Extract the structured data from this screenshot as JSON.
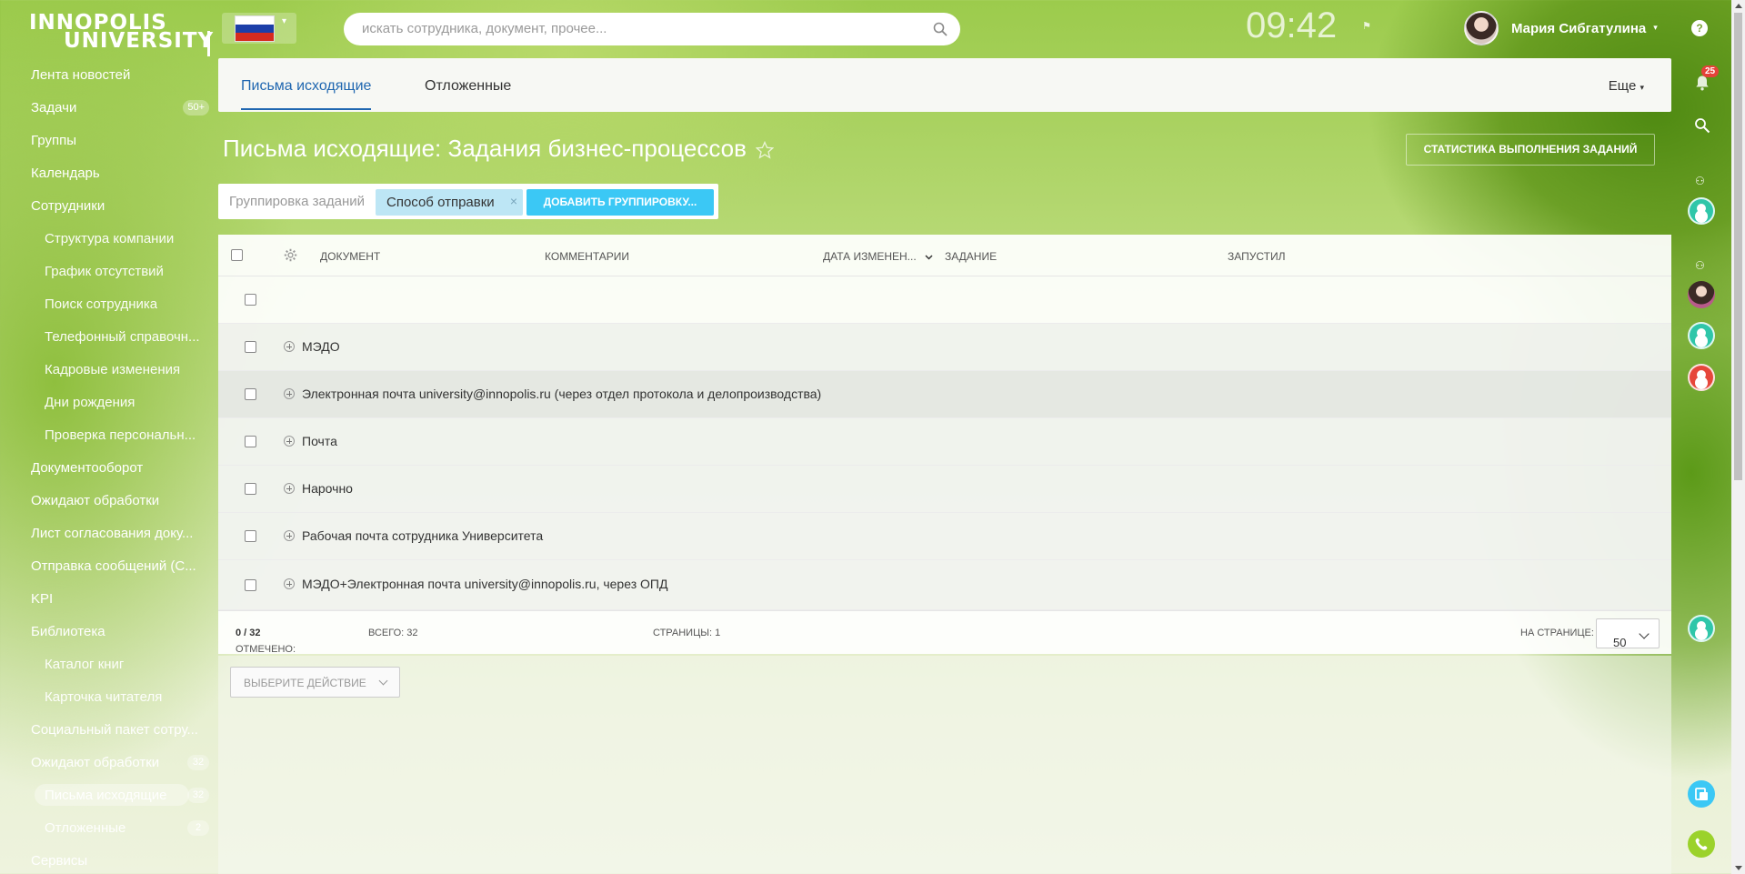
{
  "brand": {
    "line1": "INNOPOLIS",
    "line2": "UNIVERSITY"
  },
  "search": {
    "placeholder": "искать сотрудника, документ, прочее..."
  },
  "header": {
    "clock": "09:42",
    "user_name": "Мария Сибгатулина",
    "help": "?",
    "notifications_count": "25"
  },
  "sidebar": {
    "items": [
      {
        "label": "Лента новостей",
        "level": "top"
      },
      {
        "label": "Задачи",
        "level": "top",
        "count": "50+"
      },
      {
        "label": "Группы",
        "level": "top"
      },
      {
        "label": "Календарь",
        "level": "top"
      },
      {
        "label": "Сотрудники",
        "level": "top"
      },
      {
        "label": "Структура компании",
        "level": "sub"
      },
      {
        "label": "График отсутствий",
        "level": "sub"
      },
      {
        "label": "Поиск сотрудника",
        "level": "sub"
      },
      {
        "label": "Телефонный справочн...",
        "level": "sub"
      },
      {
        "label": "Кадровые изменения",
        "level": "sub"
      },
      {
        "label": "Дни рождения",
        "level": "sub"
      },
      {
        "label": "Проверка персональн...",
        "level": "sub"
      },
      {
        "label": "Документооборот",
        "level": "top"
      },
      {
        "label": "Ожидают обработки",
        "level": "top"
      },
      {
        "label": "Лист согласования доку...",
        "level": "top"
      },
      {
        "label": "Отправка сообщений (С...",
        "level": "top"
      },
      {
        "label": "KPI",
        "level": "top"
      },
      {
        "label": "Библиотека",
        "level": "top"
      },
      {
        "label": "Каталог книг",
        "level": "sub"
      },
      {
        "label": "Карточка читателя",
        "level": "sub"
      },
      {
        "label": "Социальный пакет сотру...",
        "level": "top"
      },
      {
        "label": "Ожидают обработки",
        "level": "top",
        "count": "32"
      },
      {
        "label": "Письма исходящие",
        "level": "sub",
        "count": "32",
        "active": true
      },
      {
        "label": "Отложенные",
        "level": "sub",
        "count": "2"
      },
      {
        "label": "Сервисы",
        "level": "top"
      }
    ]
  },
  "tabs": {
    "outgoing": "Письма исходящие",
    "deferred": "Отложенные",
    "more": "Еще"
  },
  "page": {
    "title": "Письма исходящие: Задания бизнес-процессов",
    "stats_button": "СТАТИСТИКА ВЫПОЛНЕНИЯ ЗАДАНИЙ"
  },
  "grouping": {
    "label": "Группировка заданий",
    "chip": "Способ отправки",
    "chip_remove": "×",
    "add_button": "ДОБАВИТЬ ГРУППИРОВКУ..."
  },
  "grid": {
    "columns": {
      "document": "ДОКУМЕНТ",
      "comments": "КОММЕНТАРИИ",
      "date": "ДАТА ИЗМЕНЕН...",
      "task": "ЗАДАНИЕ",
      "started": "ЗАПУСТИЛ"
    },
    "groups": [
      "МЭДО",
      "Электронная почта university@innopolis.ru (через отдел протокола и делопроизводства)",
      "Почта",
      "Нарочно",
      "Рабочая почта сотрудника Университета",
      "МЭДО+Электронная почта university@innopolis.ru, через ОПД"
    ],
    "footer": {
      "selected_label": "ОТМЕЧЕНО:",
      "selected_value": "0 / 32",
      "total": "ВСЕГО: 32",
      "pages": "СТРАНИЦЫ:  1",
      "per_page_label": "НА СТРАНИЦЕ:",
      "per_page_value": "50"
    }
  },
  "actions": {
    "select_placeholder": "ВЫБЕРИТЕ ДЕЙСТВИЕ"
  },
  "colors": {
    "accent_blue": "#2067b0",
    "add_button": "#3bc8f5",
    "chip": "#bde6f5",
    "badge_red": "#e5423a"
  }
}
